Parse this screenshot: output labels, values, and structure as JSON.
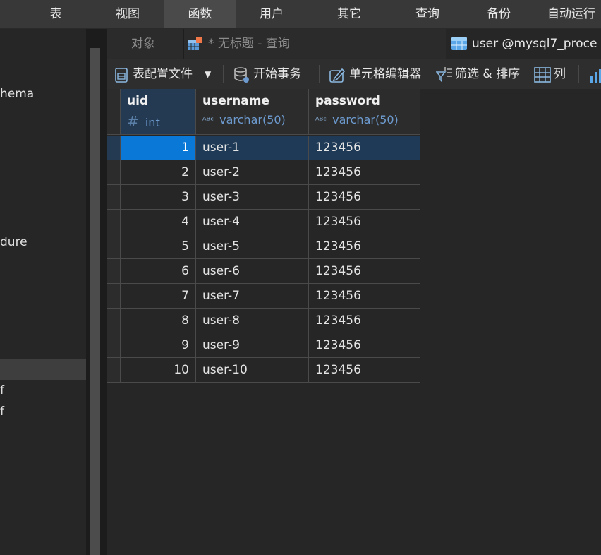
{
  "menu": {
    "items": [
      {
        "label": "表"
      },
      {
        "label": "视图"
      },
      {
        "label": "函数"
      },
      {
        "label": "用户"
      },
      {
        "label": "其它"
      },
      {
        "label": "查询"
      },
      {
        "label": "备份"
      },
      {
        "label": "自动运行"
      }
    ],
    "active_index": 2
  },
  "sidebar": {
    "items": [
      {
        "label": "hema"
      },
      {
        "label": "dure"
      },
      {
        "label": "f"
      },
      {
        "label": "f"
      }
    ]
  },
  "tabs": [
    {
      "label": "对象"
    },
    {
      "label": "* 无标题 - 查询"
    },
    {
      "label": "user @mysql7_proce"
    }
  ],
  "toolbar": {
    "profile_label": "表配置文件",
    "begin_tx_label": "开始事务",
    "cell_editor_label": "单元格编辑器",
    "filter_sort_label": "筛选 & 排序",
    "columns_label": "列"
  },
  "table": {
    "columns": [
      {
        "name": "uid",
        "type": "int",
        "type_icon": "hash-icon"
      },
      {
        "name": "username",
        "type": "varchar(50)",
        "type_icon": "text-type-icon"
      },
      {
        "name": "password",
        "type": "varchar(50)",
        "type_icon": "text-type-icon"
      }
    ],
    "rows": [
      {
        "uid": "1",
        "username": "user-1",
        "password": "123456"
      },
      {
        "uid": "2",
        "username": "user-2",
        "password": "123456"
      },
      {
        "uid": "3",
        "username": "user-3",
        "password": "123456"
      },
      {
        "uid": "4",
        "username": "user-4",
        "password": "123456"
      },
      {
        "uid": "5",
        "username": "user-5",
        "password": "123456"
      },
      {
        "uid": "6",
        "username": "user-6",
        "password": "123456"
      },
      {
        "uid": "7",
        "username": "user-7",
        "password": "123456"
      },
      {
        "uid": "8",
        "username": "user-8",
        "password": "123456"
      },
      {
        "uid": "9",
        "username": "user-9",
        "password": "123456"
      },
      {
        "uid": "10",
        "username": "user-10",
        "password": "123456"
      }
    ],
    "selected_row": 0,
    "selected_column": "uid"
  },
  "colors": {
    "accent": "#0a78d7",
    "selection_row": "#1e3a56",
    "type_text": "#6d9bd0"
  }
}
